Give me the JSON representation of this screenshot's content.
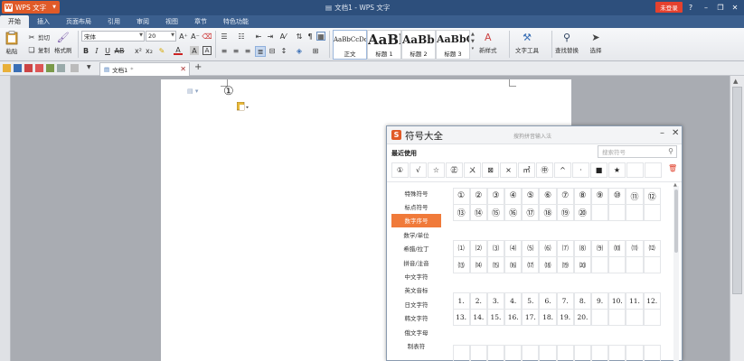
{
  "titlebar": {
    "app_name": "WPS 文字",
    "doc_title": "文档1 - WPS 文字",
    "login": "未登录"
  },
  "menu": {
    "tabs": [
      "开始",
      "插入",
      "页面布局",
      "引用",
      "审阅",
      "视图",
      "章节",
      "特色功能"
    ],
    "active": "开始"
  },
  "ribbon": {
    "paste": "粘贴",
    "cut": "剪切",
    "copy": "复制",
    "format_painter": "格式刷",
    "font_name": "宋体",
    "font_size": "20",
    "styles": [
      {
        "sample": "AaBbCcDd",
        "label": "正文"
      },
      {
        "sample": "AaBl",
        "label": "标题 1"
      },
      {
        "sample": "AaBb(",
        "label": "标题 2"
      },
      {
        "sample": "AaBbC",
        "label": "标题 3"
      }
    ],
    "new_style": "新样式",
    "text_tools": "文字工具",
    "find_replace": "查找替换",
    "select": "选择"
  },
  "quickbar": {
    "doc_tab": "文档1"
  },
  "document": {
    "content": "①"
  },
  "dialog": {
    "title": "符号大全",
    "hint": "搜狗拼音输入法",
    "recent_label": "最近使用",
    "search_placeholder": "搜索符号",
    "recent": [
      "①",
      "√",
      "☆",
      "㊣",
      "ㄨ",
      "⊠",
      "×",
      "㎡",
      "㊥",
      "^",
      "·",
      "■",
      "★",
      "",
      ""
    ],
    "categories": [
      "特殊符号",
      "标点符号",
      "数字序号",
      "数学/单位",
      "希腊/拉丁",
      "拼音/注音",
      "中文字符",
      "英文音标",
      "日文字符",
      "韩文字符",
      "俄文字母",
      "制表符"
    ],
    "active_category": "数字序号",
    "circled": [
      "①",
      "②",
      "③",
      "④",
      "⑤",
      "⑥",
      "⑦",
      "⑧",
      "⑨",
      "⑩",
      "⑪",
      "⑫",
      "⑬",
      "⑭",
      "⑮",
      "⑯",
      "⑰",
      "⑱",
      "⑲",
      "⑳"
    ],
    "parenthesized": [
      "⑴",
      "⑵",
      "⑶",
      "⑷",
      "⑸",
      "⑹",
      "⑺",
      "⑻",
      "⑼",
      "⑽",
      "⑾",
      "⑿",
      "⒀",
      "⒁",
      "⒂",
      "⒃",
      "⒄",
      "⒅",
      "⒆",
      "⒇"
    ],
    "dotted": [
      "1.",
      "2.",
      "3.",
      "4.",
      "5.",
      "6.",
      "7.",
      "8.",
      "9.",
      "10.",
      "11.",
      "12.",
      "13.",
      "14.",
      "15.",
      "16.",
      "17.",
      "18.",
      "19.",
      "20."
    ]
  },
  "colors": {
    "titlebar": "#2d4f7c",
    "accent": "#f07a3a",
    "login": "#e5412e"
  }
}
